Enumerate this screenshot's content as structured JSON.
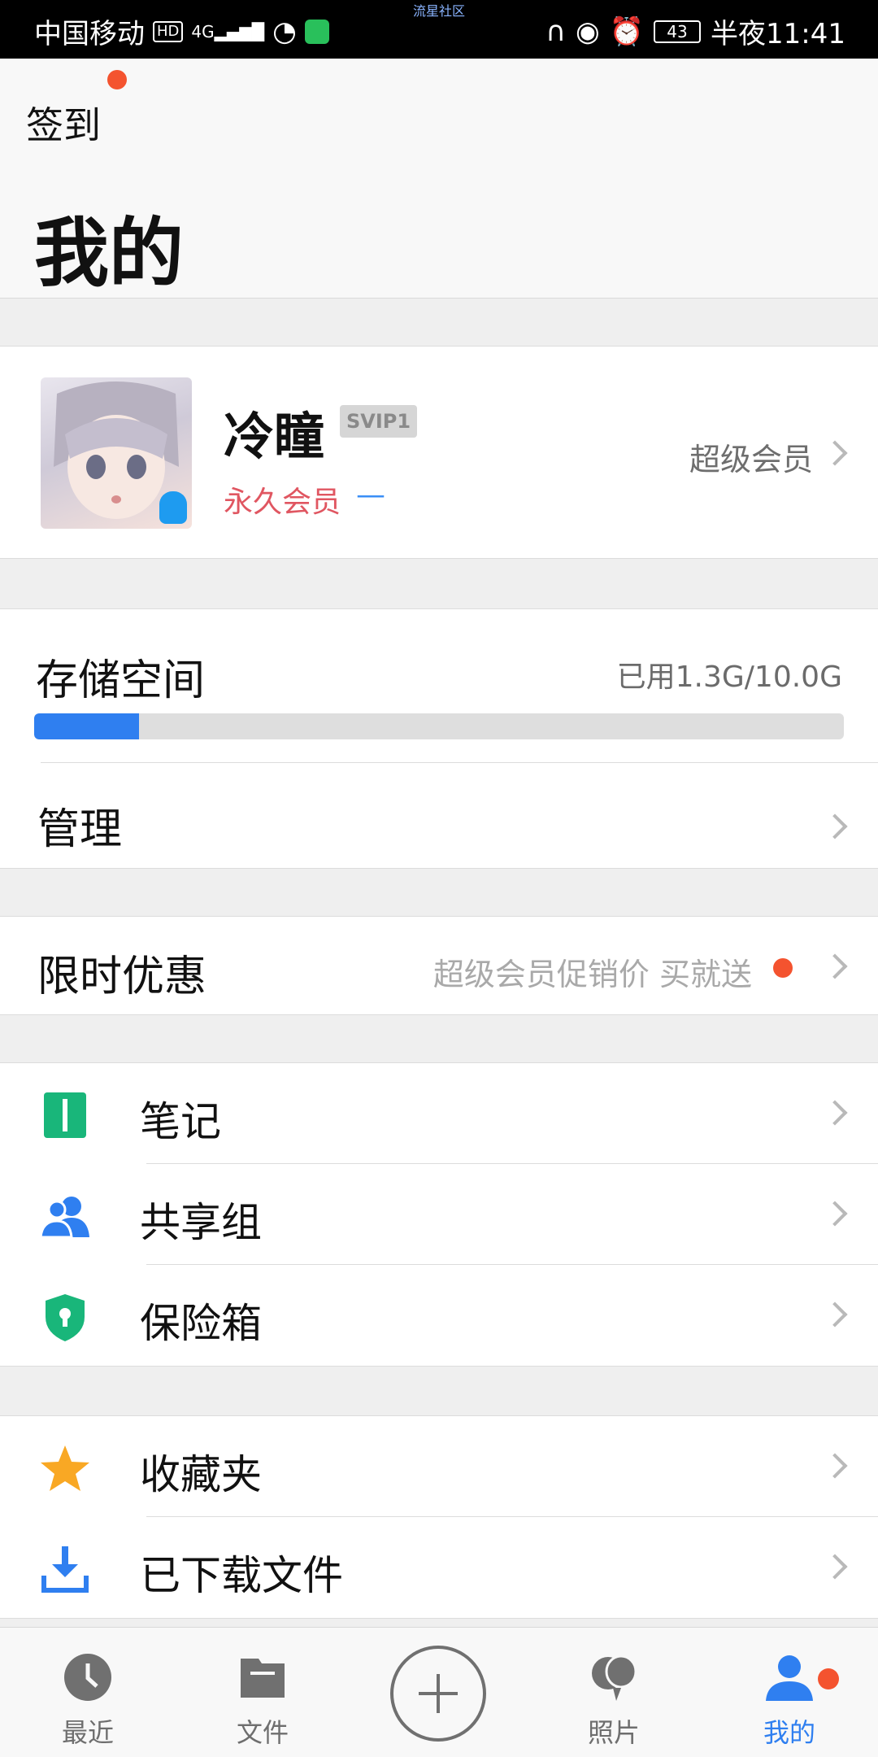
{
  "status_bar": {
    "carrier": "中国移动",
    "hd": "HD",
    "network": "4G",
    "center_label": "流星社区",
    "battery": "43",
    "time": "半夜11:41"
  },
  "header": {
    "checkin_label": "签到",
    "title": "我的"
  },
  "profile": {
    "username": "冷瞳",
    "vip_badge": "SVIP1",
    "membership": "永久会员",
    "membership_extra": "—",
    "super_member_link": "超级会员"
  },
  "storage": {
    "title": "存储空间",
    "used_text": "已用1.3G/10.0G",
    "used_fraction": 0.13,
    "manage_label": "管理"
  },
  "promo": {
    "title": "限时优惠",
    "subtitle": "超级会员促销价 买就送"
  },
  "tools": {
    "items": [
      {
        "label": "笔记",
        "icon": "note-icon"
      },
      {
        "label": "共享组",
        "icon": "share-group-icon"
      },
      {
        "label": "保险箱",
        "icon": "safe-box-icon"
      }
    ]
  },
  "more": {
    "items": [
      {
        "label": "收藏夹",
        "icon": "star-icon"
      },
      {
        "label": "已下载文件",
        "icon": "download-icon"
      }
    ]
  },
  "tabbar": {
    "items": [
      {
        "label": "最近",
        "icon": "clock-icon"
      },
      {
        "label": "文件",
        "icon": "folder-icon"
      },
      {
        "label": "",
        "icon": "add-icon"
      },
      {
        "label": "照片",
        "icon": "photo-icon"
      },
      {
        "label": "我的",
        "icon": "person-icon"
      }
    ],
    "active": "我的"
  },
  "colors": {
    "accent": "#2f7ff0",
    "notify_dot": "#f4532f",
    "member_text": "#e05661",
    "note_green": "#19b67a"
  }
}
